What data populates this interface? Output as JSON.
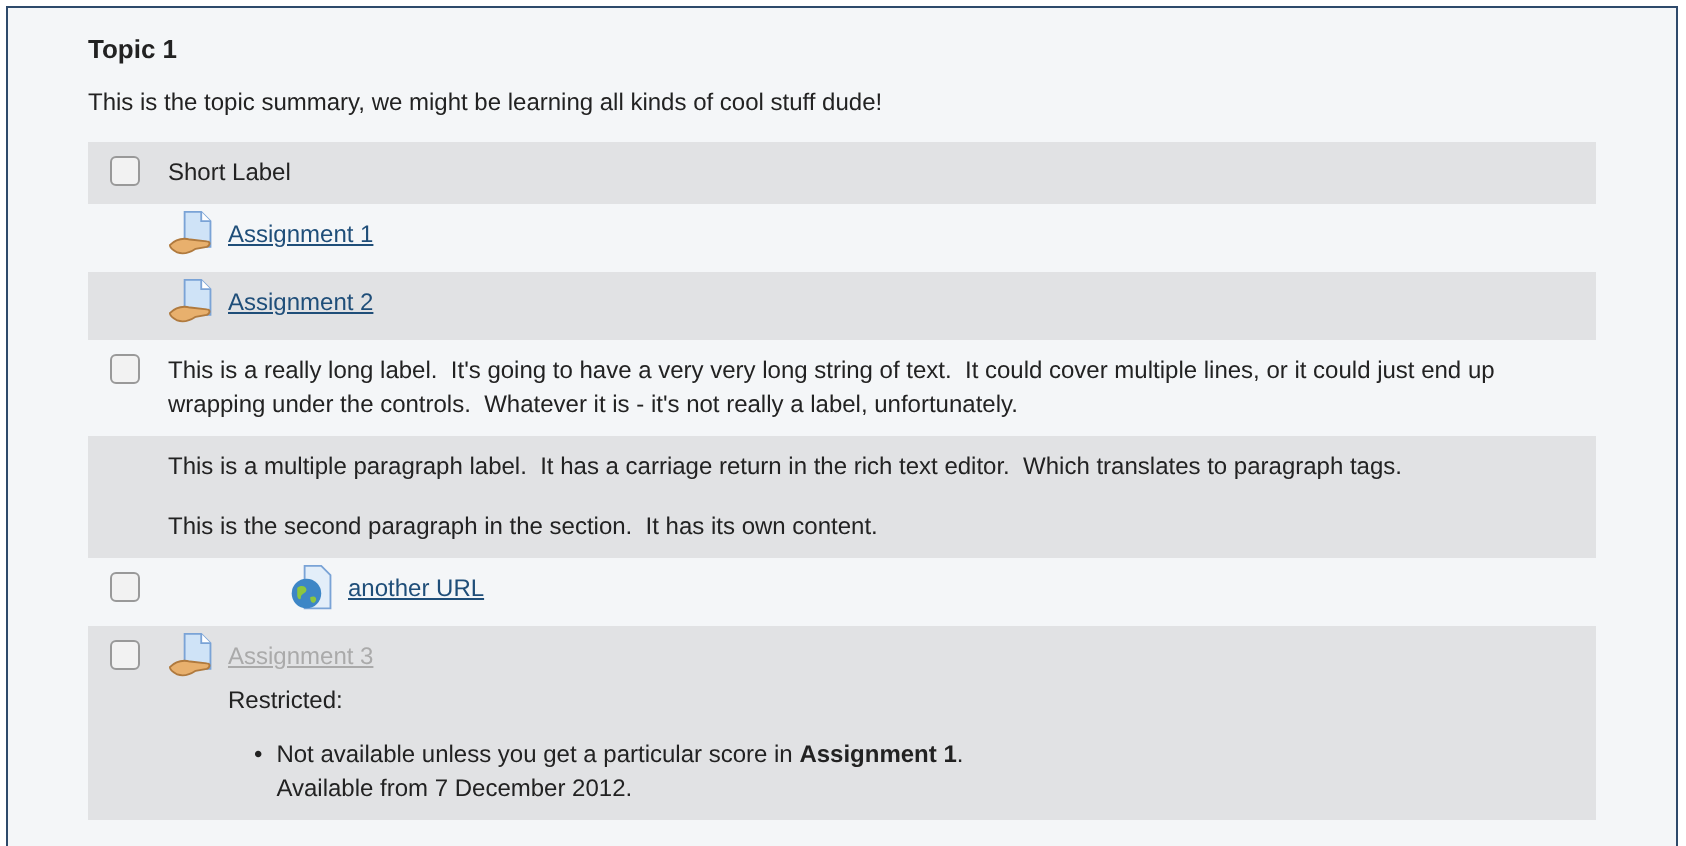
{
  "section": {
    "title": "Topic 1",
    "summary": "This is the topic summary, we might be learning all kinds of cool stuff dude!",
    "rows": [
      {
        "kind": "label",
        "checked": false,
        "paragraphs": [
          "Short Label"
        ]
      },
      {
        "kind": "assignment",
        "link": "Assignment 1",
        "indented": false,
        "dimmed": false
      },
      {
        "kind": "assignment",
        "link": "Assignment 2",
        "indented": false,
        "dimmed": false
      },
      {
        "kind": "label",
        "checked": false,
        "paragraphs": [
          "This is a really long label.  It's going to have a very very long string of text.  It could cover multiple lines, or it could just end up wrapping under the controls.  Whatever it is - it's not really a label, unfortunately."
        ]
      },
      {
        "kind": "label",
        "paragraphs": [
          "This is a multiple paragraph label.  It has a carriage return in the rich text editor.  Which translates to paragraph tags.",
          "This is the second paragraph in the section.  It has its own content."
        ]
      },
      {
        "kind": "url",
        "checked": false,
        "link": "another URL",
        "indented": true,
        "dimmed": false
      },
      {
        "kind": "assignment",
        "checked": false,
        "link": "Assignment 3",
        "indented": false,
        "dimmed": true,
        "restriction": {
          "label": "Restricted:",
          "items": [
            {
              "marker": "•",
              "lines": [
                "Not available unless you get a particular score in **Assignment 1**.",
                "Available from 7 December 2012."
              ]
            }
          ]
        }
      }
    ]
  }
}
